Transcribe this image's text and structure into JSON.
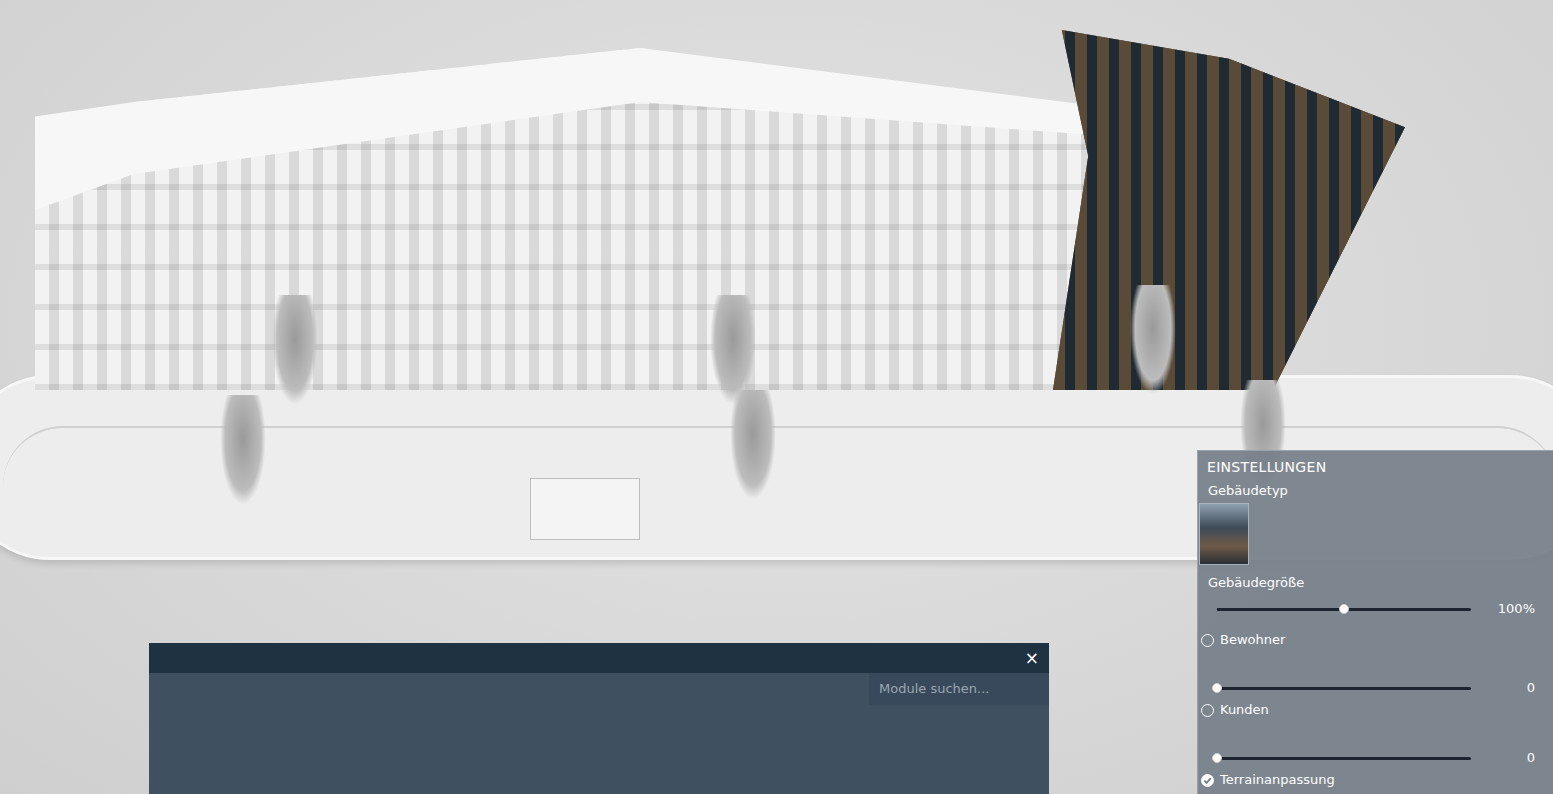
{
  "settings_panel": {
    "title": "EINSTELLUNGEN",
    "building_type": {
      "label": "Gebäudetyp"
    },
    "rows": [
      {
        "kind": "slider",
        "label": "Gebäudegröße",
        "level": 0.5,
        "reading": "100%"
      },
      {
        "kind": "radioslider",
        "label": "Bewohner",
        "selected": false,
        "level": 0,
        "reading": "0"
      },
      {
        "kind": "radioslider",
        "label": "Kunden",
        "selected": false,
        "level": 0,
        "reading": "0"
      },
      {
        "kind": "checkbox",
        "label": "Terrainanpassung",
        "checked": true
      }
    ]
  },
  "module_panel": {
    "close": "×",
    "search": {
      "placeholder": "Module suchen..."
    }
  }
}
